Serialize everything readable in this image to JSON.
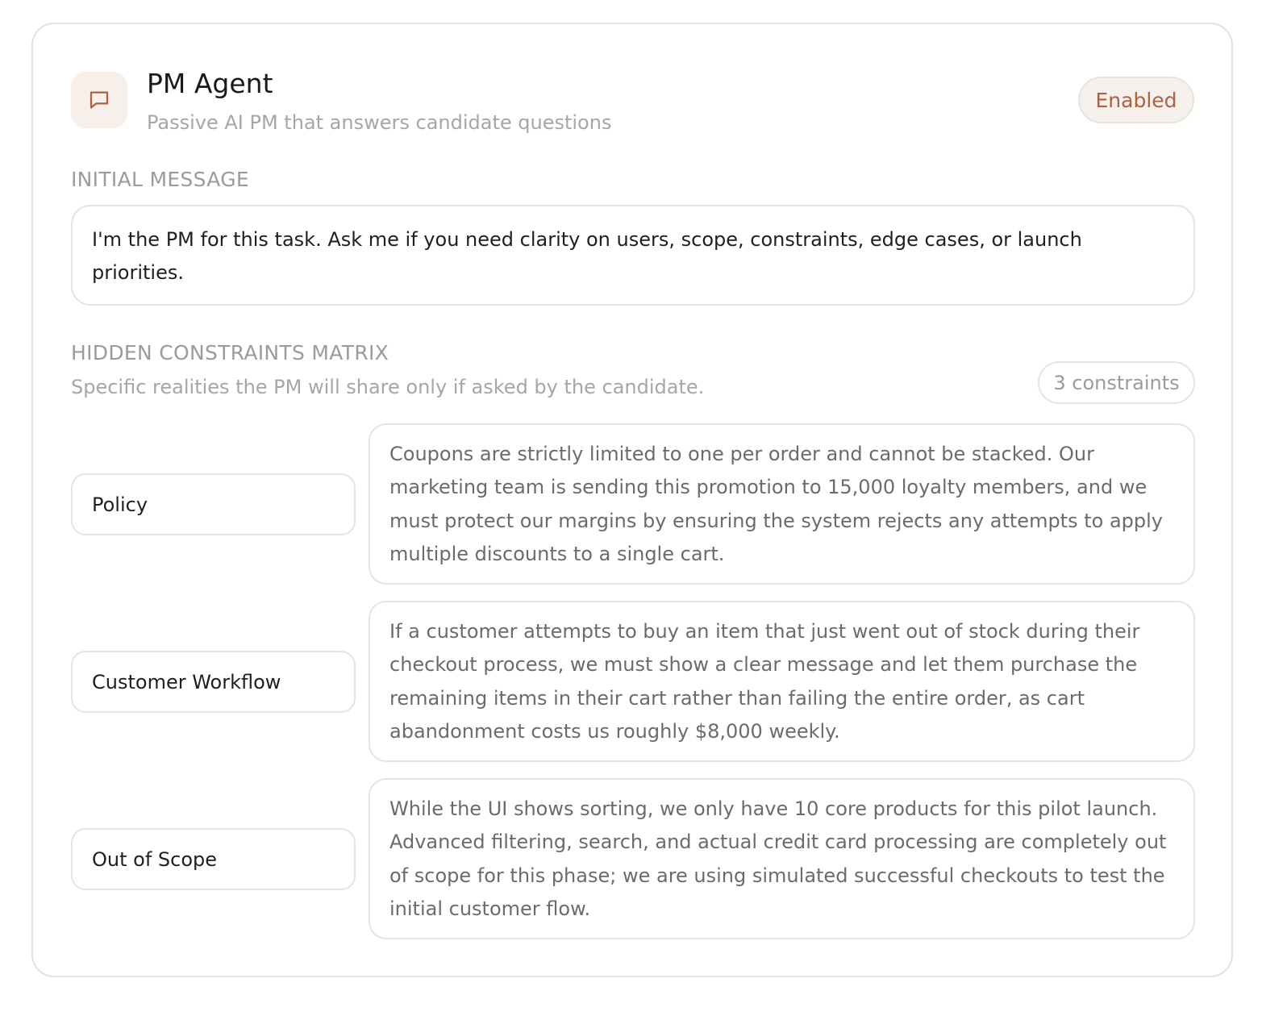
{
  "agent": {
    "icon": "message-square-icon",
    "title": "PM Agent",
    "subtitle": "Passive AI PM that answers candidate questions",
    "status": "Enabled",
    "accent_color": "#b0603f"
  },
  "initial_message": {
    "label": "INITIAL MESSAGE",
    "text": "I'm the PM for this task. Ask me if you need clarity on users, scope, constraints, edge cases, or launch priorities."
  },
  "matrix": {
    "label": "HIDDEN CONSTRAINTS MATRIX",
    "description": "Specific realities the PM will share only if asked by the candidate.",
    "count_label": "3 constraints",
    "constraints": [
      {
        "type": "Policy",
        "text": "Coupons are strictly limited to one per order and cannot be stacked. Our marketing team is sending this promotion to 15,000 loyalty members, and we must protect our margins by ensuring the system rejects any attempts to apply multiple discounts to a single cart."
      },
      {
        "type": "Customer Workflow",
        "text": "If a customer attempts to buy an item that just went out of stock during their checkout process, we must show a clear message and let them purchase the remaining items in their cart rather than failing the entire order, as cart abandonment costs us roughly $8,000 weekly."
      },
      {
        "type": "Out of Scope",
        "text": "While the UI shows sorting, we only have 10 core products for this pilot launch. Advanced filtering, search, and actual credit card processing are completely out of scope for this phase; we are using simulated successful checkouts to test the initial customer flow."
      }
    ]
  }
}
